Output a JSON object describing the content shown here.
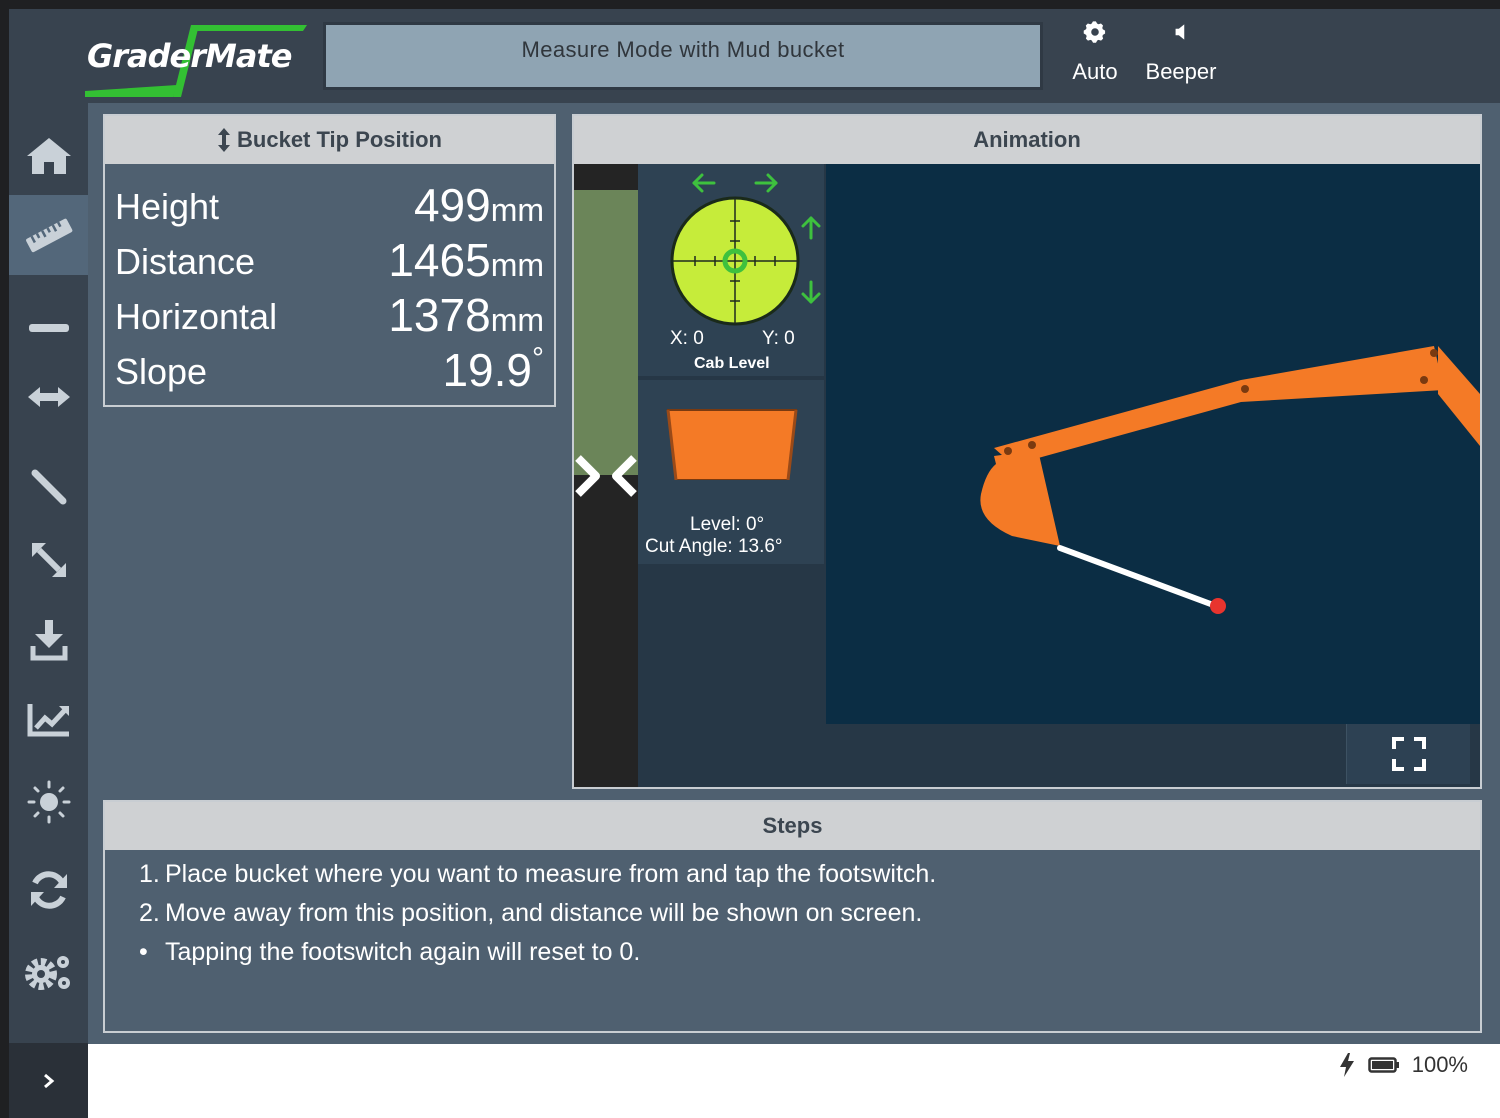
{
  "app": {
    "logo_text": "GraderMate",
    "mode_title": "Measure Mode with Mud bucket"
  },
  "header": {
    "auto_label": "Auto",
    "auto_icon": "gear-icon",
    "beeper_label": "Beeper",
    "beeper_icon": "speaker-icon"
  },
  "sidebar": {
    "items": [
      {
        "name": "home",
        "icon": "home-icon",
        "active": false
      },
      {
        "name": "measure",
        "icon": "ruler-icon",
        "active": true
      },
      {
        "name": "level",
        "icon": "minus-icon",
        "active": false
      },
      {
        "name": "horizontal",
        "icon": "horizontal-arrows-icon",
        "active": false
      },
      {
        "name": "slope",
        "icon": "slope-line-icon",
        "active": false
      },
      {
        "name": "diagonal",
        "icon": "diagonal-arrows-icon",
        "active": false
      },
      {
        "name": "download",
        "icon": "download-icon",
        "active": false
      },
      {
        "name": "chart",
        "icon": "trend-chart-icon",
        "active": false
      },
      {
        "name": "brightness",
        "icon": "sun-icon",
        "active": false
      },
      {
        "name": "sync",
        "icon": "sync-icon",
        "active": false
      },
      {
        "name": "settings",
        "icon": "gears-icon",
        "active": false
      }
    ],
    "expand_icon": "chevron-right-icon"
  },
  "bucket_tip": {
    "title": "Bucket Tip Position",
    "rows": [
      {
        "label": "Height",
        "value": "499",
        "unit": "mm"
      },
      {
        "label": "Distance",
        "value": "1465",
        "unit": "mm"
      },
      {
        "label": "Horizontal",
        "value": "1378",
        "unit": "mm"
      },
      {
        "label": "Slope",
        "value": "19.9",
        "unit": "°"
      }
    ]
  },
  "animation": {
    "title": "Animation",
    "cab": {
      "x_text": "X: 0",
      "y_text": "Y: 0",
      "label": "Cab Level"
    },
    "bucket": {
      "level_text": "Level: 0°",
      "cut_angle_text": "Cut Angle: 13.6°"
    },
    "colors": {
      "boom": "#f47a26",
      "level_green": "#6b8559",
      "bubble": "#c6ec3a",
      "arrows": "#3ec13e",
      "tip_point": "#e8342e"
    }
  },
  "steps": {
    "title": "Steps",
    "lines": [
      {
        "marker": "1.",
        "text": "Place bucket where you want to measure from and tap the footswitch."
      },
      {
        "marker": "2.",
        "text": "Move away from this position, and distance will be shown on screen."
      },
      {
        "marker": "•",
        "text": "Tapping the footswitch again will reset to 0."
      }
    ]
  },
  "status": {
    "battery_percent": "100%",
    "battery_level": 1.0
  }
}
